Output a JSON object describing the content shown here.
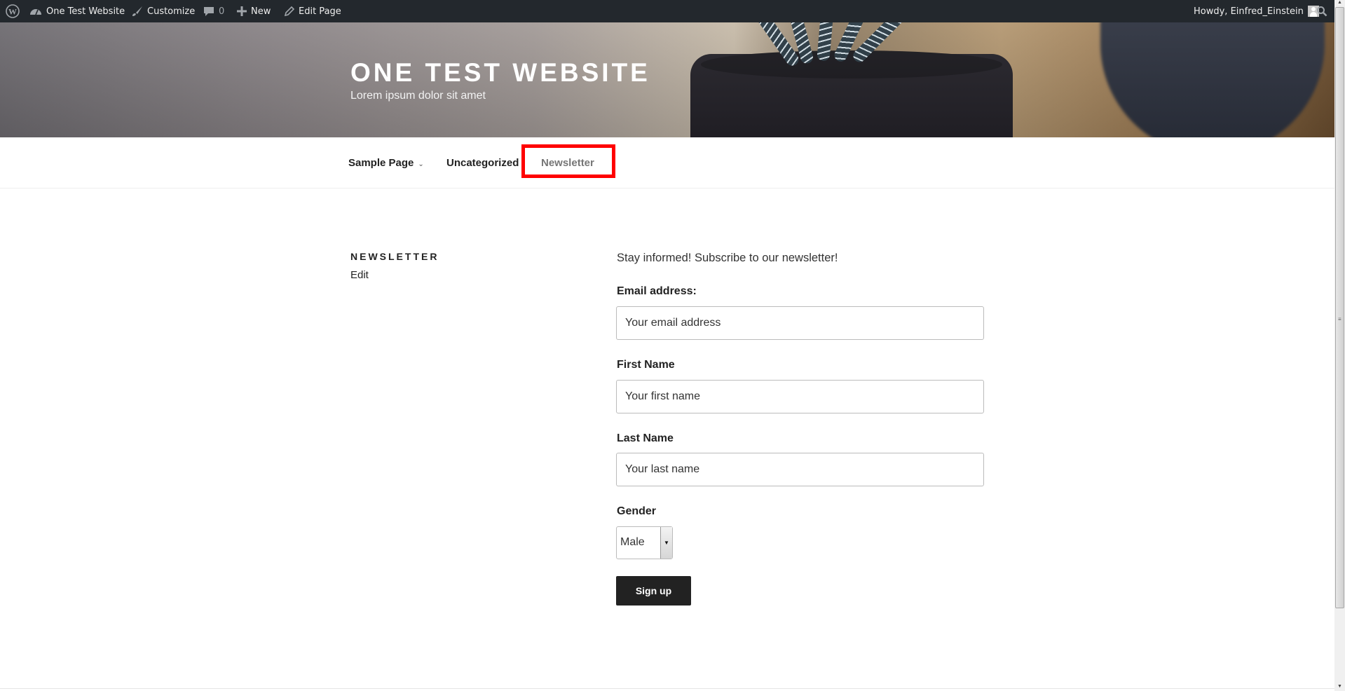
{
  "adminbar": {
    "site_name": "One Test Website",
    "customize": "Customize",
    "comments_count": "0",
    "new": "New",
    "edit_page": "Edit Page",
    "greeting": "Howdy, Einfred_Einstein"
  },
  "header": {
    "site_title": "ONE TEST WEBSITE",
    "site_description": "Lorem ipsum dolor sit amet"
  },
  "nav": {
    "items": [
      {
        "label": "Sample Page",
        "has_submenu": true
      },
      {
        "label": "Uncategorized",
        "has_submenu": false
      },
      {
        "label": "Newsletter",
        "current": true
      }
    ],
    "highlight_color": "#ff0000"
  },
  "page": {
    "title": "NEWSLETTER",
    "edit_link": "Edit"
  },
  "form": {
    "intro": "Stay informed! Subscribe to our newsletter!",
    "email_label": "Email address:",
    "email_placeholder": "Your email address",
    "first_name_label": "First Name",
    "first_name_placeholder": "Your first name",
    "last_name_label": "Last Name",
    "last_name_placeholder": "Your last name",
    "gender_label": "Gender",
    "gender_selected": "Male",
    "submit_label": "Sign up"
  },
  "colors": {
    "adminbar_bg": "#23282d",
    "button_bg": "#222222",
    "highlight": "#ff0000"
  }
}
